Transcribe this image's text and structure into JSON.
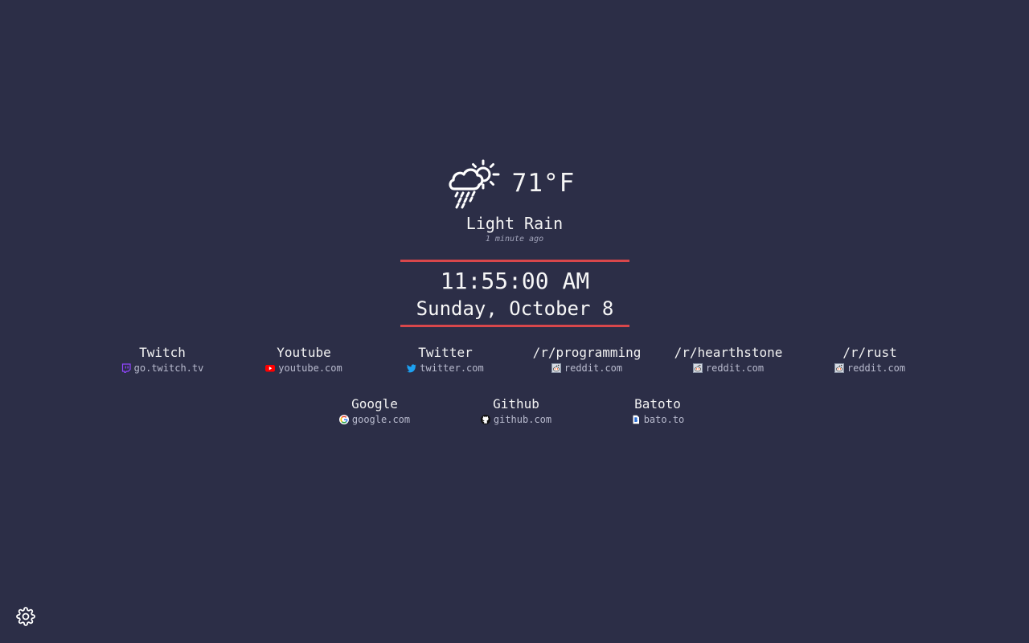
{
  "weather": {
    "icon": "cloud-rain-sun-icon",
    "temperature": "71°F",
    "condition": "Light Rain",
    "updated": "1 minute ago"
  },
  "clock": {
    "time": "11:55:00 AM",
    "date": "Sunday, October 8"
  },
  "accent_color": "#d9474b",
  "background_color": "#2c2e47",
  "links": [
    {
      "name": "Twitch",
      "url": "go.twitch.tv",
      "icon": "twitch-icon"
    },
    {
      "name": "Youtube",
      "url": "youtube.com",
      "icon": "youtube-icon"
    },
    {
      "name": "Twitter",
      "url": "twitter.com",
      "icon": "twitter-icon"
    },
    {
      "name": "/r/programming",
      "url": "reddit.com",
      "icon": "reddit-icon"
    },
    {
      "name": "/r/hearthstone",
      "url": "reddit.com",
      "icon": "reddit-icon"
    },
    {
      "name": "/r/rust",
      "url": "reddit.com",
      "icon": "reddit-icon"
    },
    {
      "name": "Google",
      "url": "google.com",
      "icon": "google-icon"
    },
    {
      "name": "Github",
      "url": "github.com",
      "icon": "github-icon"
    },
    {
      "name": "Batoto",
      "url": "bato.to",
      "icon": "batoto-icon"
    }
  ],
  "settings": {
    "icon": "gear-icon"
  }
}
